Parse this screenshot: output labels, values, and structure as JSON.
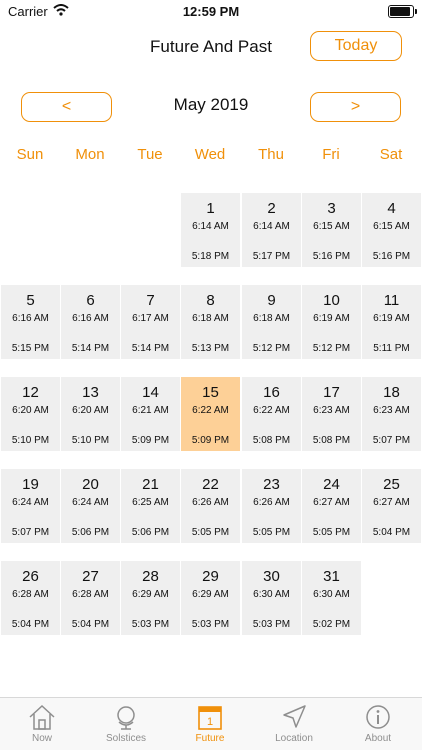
{
  "status_bar": {
    "carrier": "Carrier",
    "time": "12:59 PM"
  },
  "header": {
    "title": "Future And Past",
    "today_label": "Today"
  },
  "nav": {
    "prev_label": "<",
    "next_label": ">",
    "month": "May 2019"
  },
  "weekdays": [
    "Sun",
    "Mon",
    "Tue",
    "Wed",
    "Thu",
    "Fri",
    "Sat"
  ],
  "calendar": {
    "first_weekday_index": 3,
    "selected_day": 15,
    "days": [
      {
        "day": "1",
        "sunrise": "6:14 AM",
        "sunset": "5:18 PM"
      },
      {
        "day": "2",
        "sunrise": "6:14 AM",
        "sunset": "5:17 PM"
      },
      {
        "day": "3",
        "sunrise": "6:15 AM",
        "sunset": "5:16 PM"
      },
      {
        "day": "4",
        "sunrise": "6:15 AM",
        "sunset": "5:16 PM"
      },
      {
        "day": "5",
        "sunrise": "6:16 AM",
        "sunset": "5:15 PM"
      },
      {
        "day": "6",
        "sunrise": "6:16 AM",
        "sunset": "5:14 PM"
      },
      {
        "day": "7",
        "sunrise": "6:17 AM",
        "sunset": "5:14 PM"
      },
      {
        "day": "8",
        "sunrise": "6:18 AM",
        "sunset": "5:13 PM"
      },
      {
        "day": "9",
        "sunrise": "6:18 AM",
        "sunset": "5:12 PM"
      },
      {
        "day": "10",
        "sunrise": "6:19 AM",
        "sunset": "5:12 PM"
      },
      {
        "day": "11",
        "sunrise": "6:19 AM",
        "sunset": "5:11 PM"
      },
      {
        "day": "12",
        "sunrise": "6:20 AM",
        "sunset": "5:10 PM"
      },
      {
        "day": "13",
        "sunrise": "6:20 AM",
        "sunset": "5:10 PM"
      },
      {
        "day": "14",
        "sunrise": "6:21 AM",
        "sunset": "5:09 PM"
      },
      {
        "day": "15",
        "sunrise": "6:22 AM",
        "sunset": "5:09 PM"
      },
      {
        "day": "16",
        "sunrise": "6:22 AM",
        "sunset": "5:08 PM"
      },
      {
        "day": "17",
        "sunrise": "6:23 AM",
        "sunset": "5:08 PM"
      },
      {
        "day": "18",
        "sunrise": "6:23 AM",
        "sunset": "5:07 PM"
      },
      {
        "day": "19",
        "sunrise": "6:24 AM",
        "sunset": "5:07 PM"
      },
      {
        "day": "20",
        "sunrise": "6:24 AM",
        "sunset": "5:06 PM"
      },
      {
        "day": "21",
        "sunrise": "6:25 AM",
        "sunset": "5:06 PM"
      },
      {
        "day": "22",
        "sunrise": "6:26 AM",
        "sunset": "5:05 PM"
      },
      {
        "day": "23",
        "sunrise": "6:26 AM",
        "sunset": "5:05 PM"
      },
      {
        "day": "24",
        "sunrise": "6:27 AM",
        "sunset": "5:05 PM"
      },
      {
        "day": "25",
        "sunrise": "6:27 AM",
        "sunset": "5:04 PM"
      },
      {
        "day": "26",
        "sunrise": "6:28 AM",
        "sunset": "5:04 PM"
      },
      {
        "day": "27",
        "sunrise": "6:28 AM",
        "sunset": "5:04 PM"
      },
      {
        "day": "28",
        "sunrise": "6:29 AM",
        "sunset": "5:03 PM"
      },
      {
        "day": "29",
        "sunrise": "6:29 AM",
        "sunset": "5:03 PM"
      },
      {
        "day": "30",
        "sunrise": "6:30 AM",
        "sunset": "5:03 PM"
      },
      {
        "day": "31",
        "sunrise": "6:30 AM",
        "sunset": "5:02 PM"
      }
    ]
  },
  "tab_bar": {
    "active_index": 2,
    "tabs": [
      {
        "label": "Now",
        "icon": "house-icon"
      },
      {
        "label": "Solstices",
        "icon": "globe-icon"
      },
      {
        "label": "Future",
        "icon": "calendar-icon"
      },
      {
        "label": "Location",
        "icon": "location-arrow-icon"
      },
      {
        "label": "About",
        "icon": "info-icon"
      }
    ]
  },
  "colors": {
    "accent": "#f0900a",
    "cell_bg": "#efefef",
    "selected_bg": "#fdd097",
    "tab_inactive": "#8e8e8e"
  }
}
